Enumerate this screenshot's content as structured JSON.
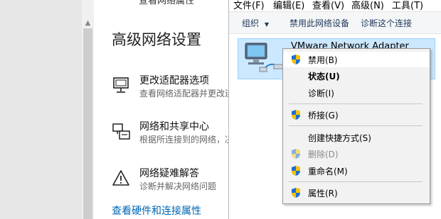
{
  "settings": {
    "top_cut_text": "查看网络属性",
    "heading": "高级网络设置",
    "items": [
      {
        "title": "更改适配器选项",
        "desc": "查看网络适配器并更改连接设置"
      },
      {
        "title": "网络和共享中心",
        "desc": "根据所连接到的网络，决定要共享的内容"
      },
      {
        "title": "网络疑难解答",
        "desc": "诊断并解决网络问题"
      }
    ],
    "link": "查看硬件和连接属性"
  },
  "netwin": {
    "menu": [
      "文件(F)",
      "编辑(E)",
      "查看(V)",
      "高级(N)",
      "工具(T)"
    ],
    "commands": [
      "组织",
      "禁用此网络设备",
      "诊断这个连接"
    ],
    "organize_arrow": "▼",
    "adapter_name": "VMware Network Adapter"
  },
  "context_menu": {
    "items": [
      {
        "label": "禁用(B)",
        "shield": true
      },
      {
        "label": "状态(U)",
        "bold": true
      },
      {
        "label": "诊断(I)"
      },
      {
        "label": "桥接(G)",
        "shield": true
      },
      {
        "label": "创建快捷方式(S)"
      },
      {
        "label": "删除(D)",
        "shield": true,
        "disabled": true
      },
      {
        "label": "重命名(M)",
        "shield": true
      },
      {
        "label": "属性(R)",
        "shield": true
      }
    ]
  },
  "colors": {
    "link": "#0066b4",
    "selection": "#cce8ff",
    "shield_blue": "#1f6fd1",
    "shield_yellow": "#f5c400"
  }
}
